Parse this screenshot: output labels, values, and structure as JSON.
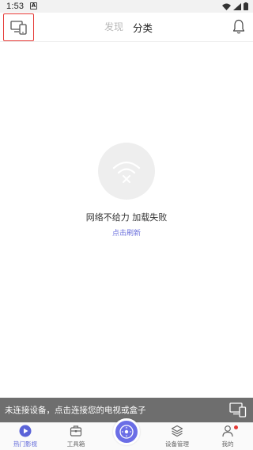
{
  "status_bar": {
    "time": "1:53",
    "notif": "A"
  },
  "header": {
    "tabs": [
      {
        "label": "发现",
        "active": false
      },
      {
        "label": "分类",
        "active": true
      }
    ]
  },
  "empty_state": {
    "message": "网络不给力 加载失败",
    "retry": "点击刷新"
  },
  "banner": {
    "text": "未连接设备，点击连接您的电视或盒子"
  },
  "bottom_nav": {
    "items": [
      {
        "label": "热门影视",
        "icon": "play-circle-icon",
        "active": true
      },
      {
        "label": "工具箱",
        "icon": "toolbox-icon",
        "active": false
      },
      {
        "label": "",
        "icon": "remote-control-icon",
        "active": false
      },
      {
        "label": "设备管理",
        "icon": "layers-icon",
        "active": false
      },
      {
        "label": "我的",
        "icon": "person-icon",
        "active": false,
        "badge": true
      }
    ]
  },
  "colors": {
    "accent": "#6b6ee6",
    "highlight_box": "#e53935",
    "banner_bg": "#6e6e6e"
  }
}
